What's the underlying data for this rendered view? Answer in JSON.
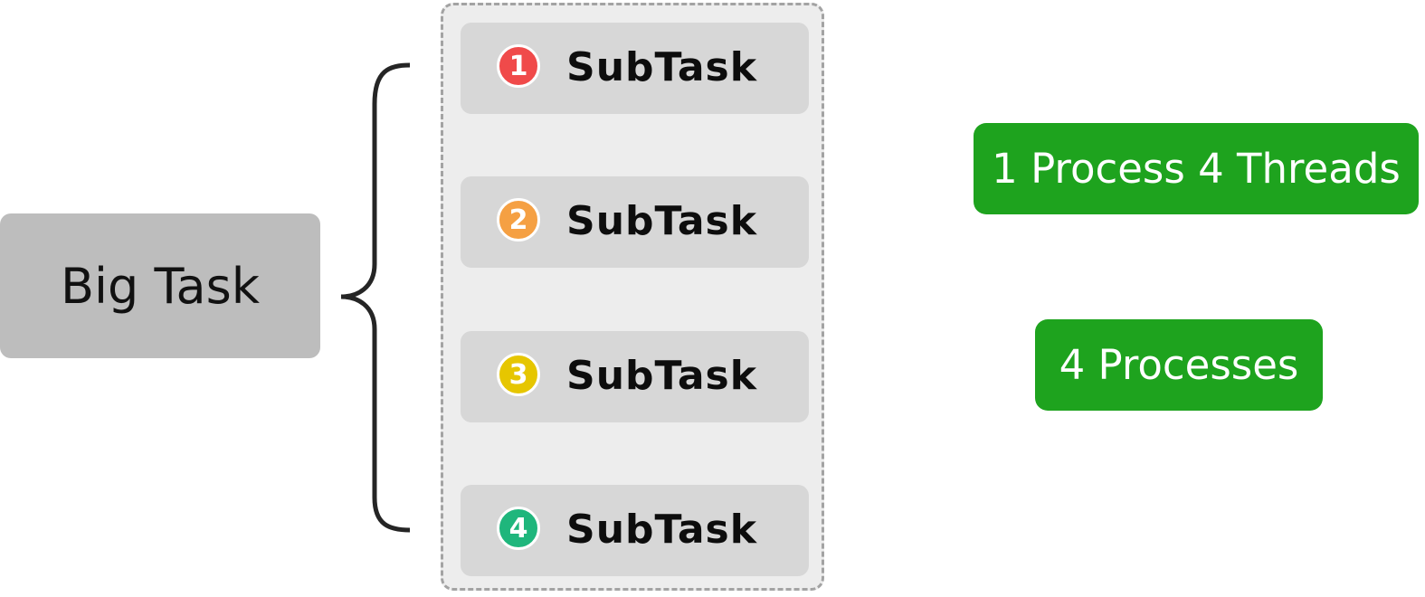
{
  "big_task": {
    "label": "Big Task"
  },
  "subtasks": [
    {
      "number": "1",
      "label": "SubTask",
      "color": "#f04a4a"
    },
    {
      "number": "2",
      "label": "SubTask",
      "color": "#f5a043"
    },
    {
      "number": "3",
      "label": "SubTask",
      "color": "#e6c600"
    },
    {
      "number": "4",
      "label": "SubTask",
      "color": "#1fb67c"
    }
  ],
  "modes": {
    "threads": {
      "label": "1 Process 4 Threads",
      "color": "#1ea31e"
    },
    "processes": {
      "label": "4 Processes",
      "color": "#1ea31e"
    }
  }
}
